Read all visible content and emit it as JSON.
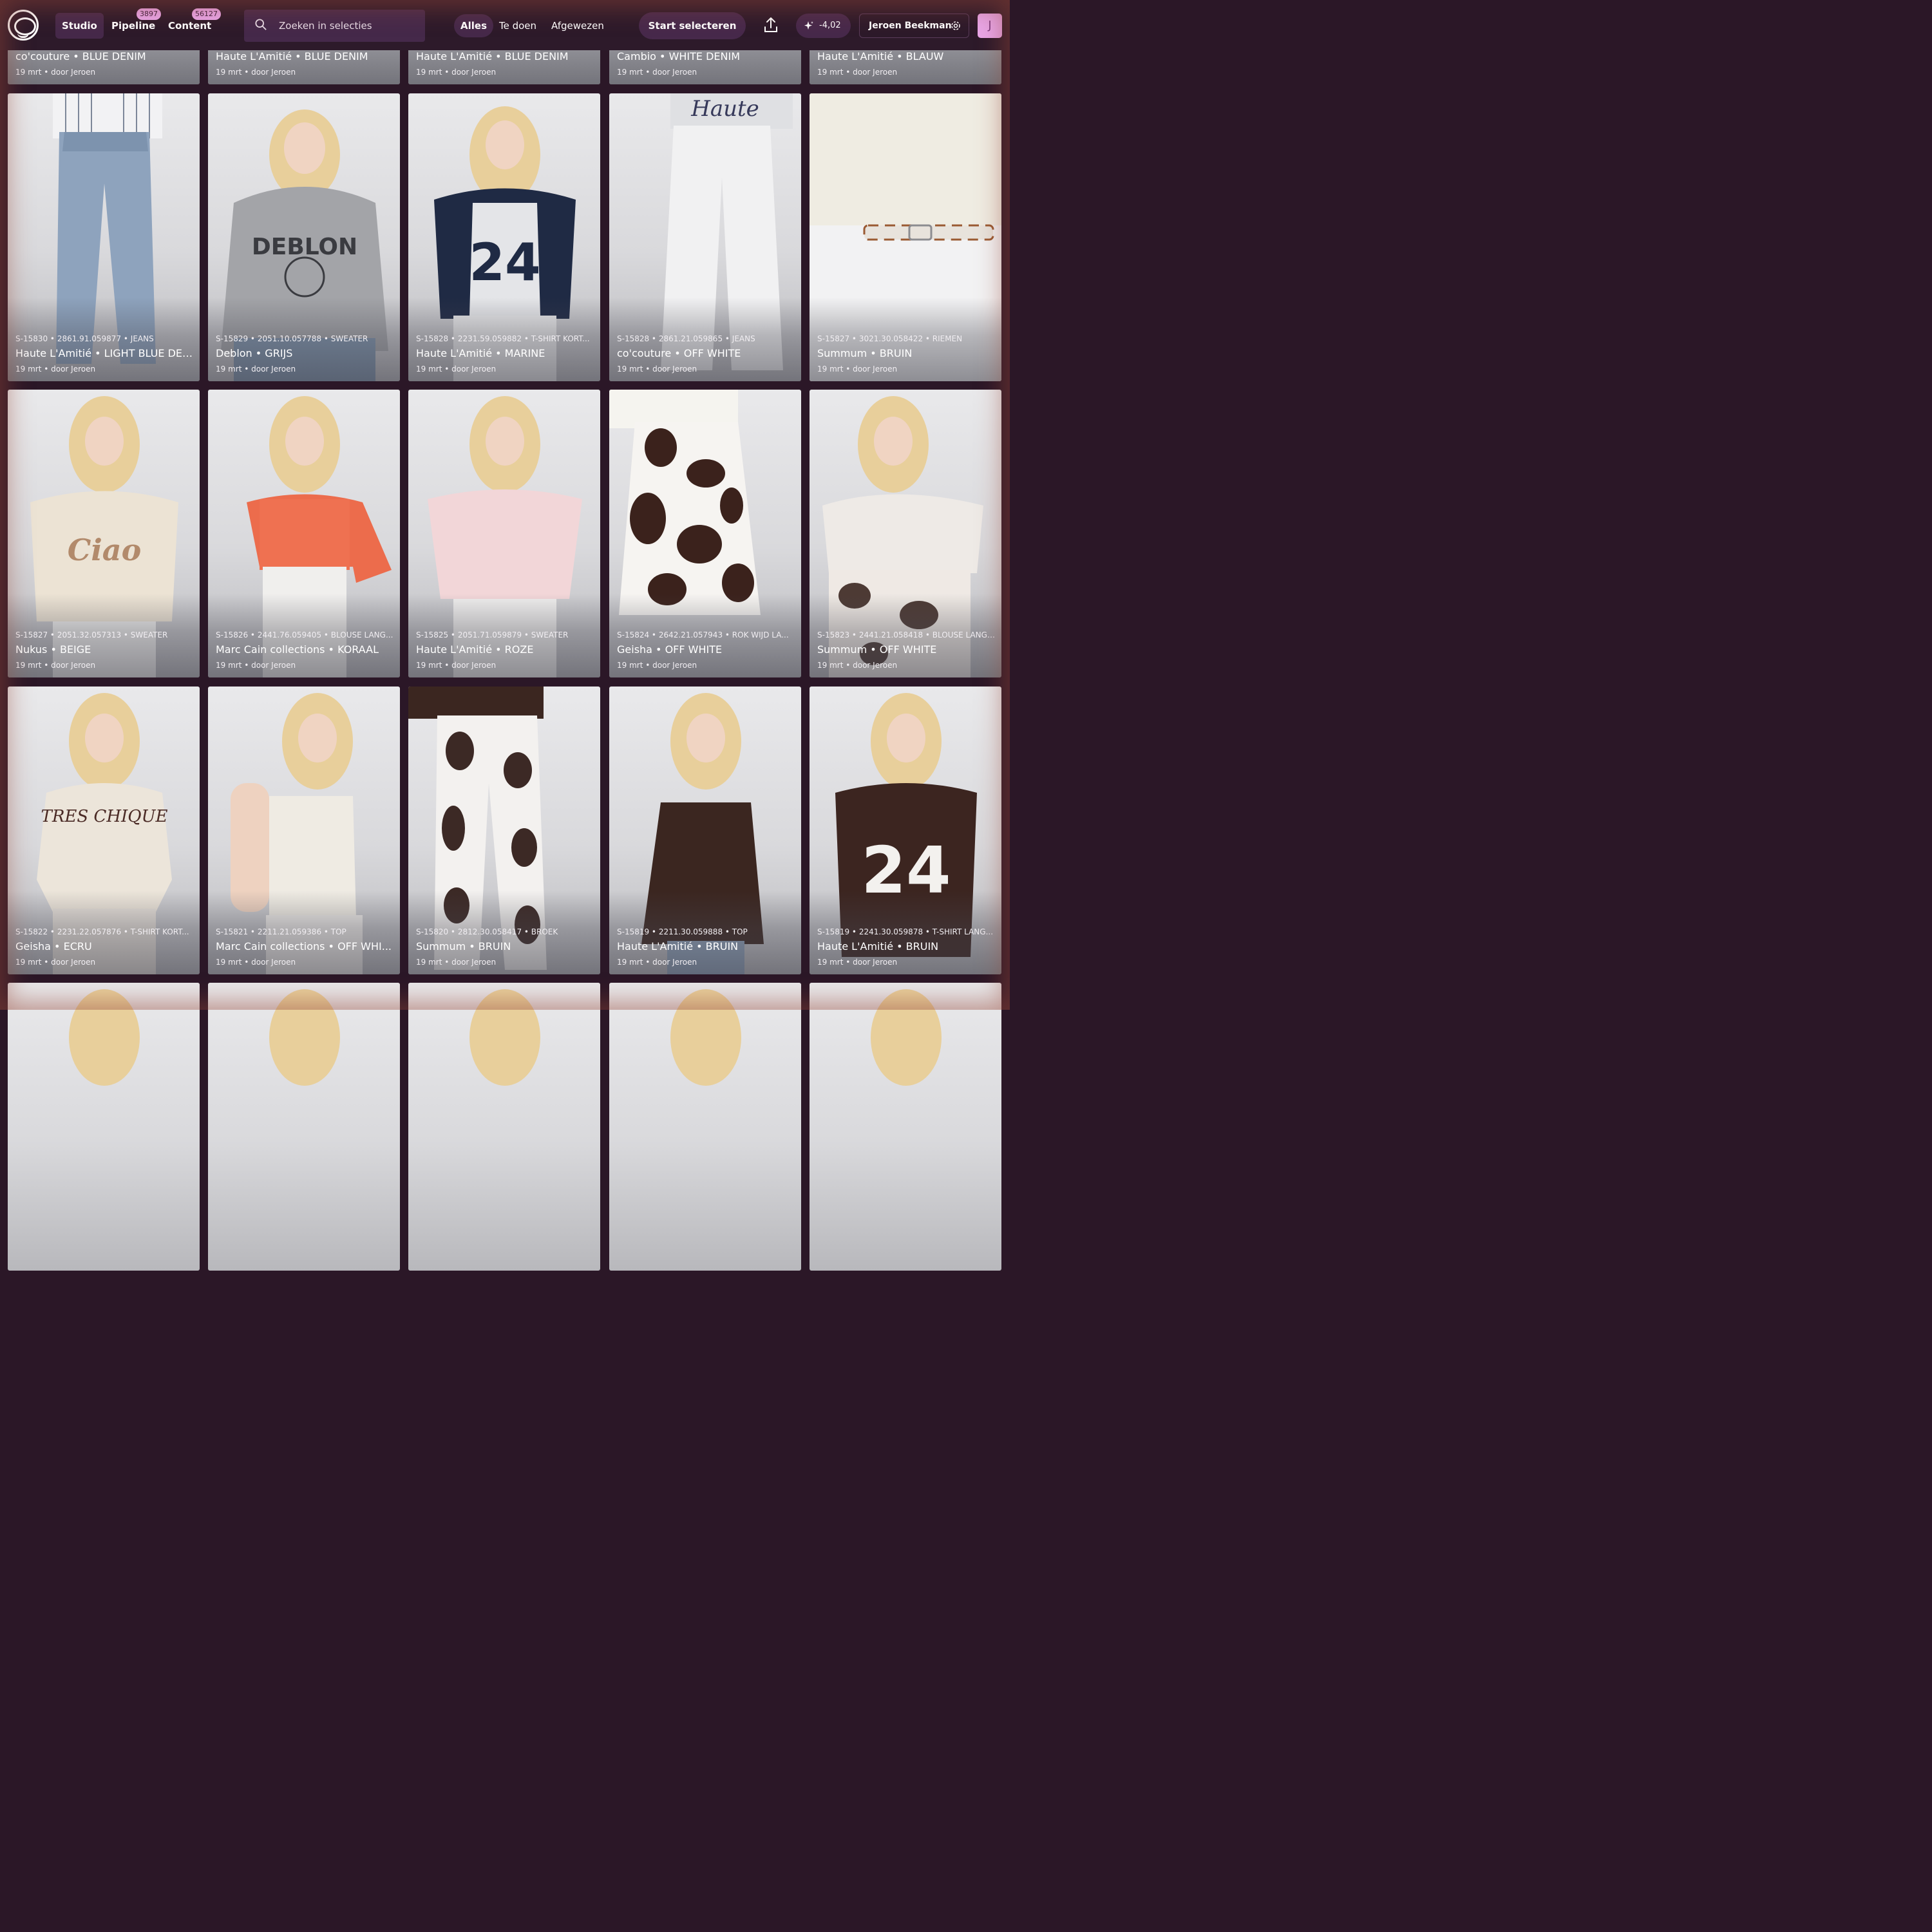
{
  "nav": {
    "tabs": [
      {
        "label": "Studio",
        "badge": ""
      },
      {
        "label": "Pipeline",
        "badge": "3897"
      },
      {
        "label": "Content",
        "badge": "56127"
      }
    ]
  },
  "search": {
    "placeholder": "Zoeken in selecties",
    "icon": "search-icon"
  },
  "filters": [
    "Alles",
    "Te doen",
    "Afgewezen"
  ],
  "actions": {
    "start_label": "Start selecteren",
    "upload_icon": "upload-icon",
    "credits": "-4,02",
    "user_name": "Jeroen Beekman",
    "avatar_initial": "J"
  },
  "colors": {
    "background": "#2b1727",
    "accent": "#e9a6e8",
    "pill": "#47294b"
  },
  "grid": {
    "row_top": [
      {
        "meta": "",
        "title": "co'couture • BLUE DENIM",
        "sub": "19 mrt • door Jeroen"
      },
      {
        "meta": "",
        "title": "Haute L'Amitié • BLUE DENIM",
        "sub": "19 mrt • door Jeroen"
      },
      {
        "meta": "",
        "title": "Haute L'Amitié • BLUE DENIM",
        "sub": "19 mrt • door Jeroen"
      },
      {
        "meta": "",
        "title": "Cambio • WHITE DENIM",
        "sub": "19 mrt • door Jeroen"
      },
      {
        "meta": "",
        "title": "Haute L'Amitié • BLAUW",
        "sub": "19 mrt • door Jeroen"
      }
    ],
    "row1": [
      {
        "meta": "S-15830 • 2861.91.059877 • JEANS",
        "title": "Haute L'Amitié • LIGHT BLUE DEN...",
        "sub": "19 mrt • door Jeroen"
      },
      {
        "meta": "S-15829 • 2051.10.057788 • SWEATER",
        "title": "Deblon • GRIJS",
        "sub": "19 mrt • door Jeroen"
      },
      {
        "meta": "S-15828 • 2231.59.059882 • T-SHIRT KORT...",
        "title": "Haute L'Amitié • MARINE",
        "sub": "19 mrt • door Jeroen"
      },
      {
        "meta": "S-15828 • 2861.21.059865 • JEANS",
        "title": "co'couture • OFF WHITE",
        "sub": "19 mrt • door Jeroen"
      },
      {
        "meta": "S-15827 • 3021.30.058422 • RIEMEN",
        "title": "Summum • BRUIN",
        "sub": "19 mrt • door Jeroen"
      }
    ],
    "row2": [
      {
        "meta": "S-15827 • 2051.32.057313 • SWEATER",
        "title": "Nukus • BEIGE",
        "sub": "19 mrt • door Jeroen"
      },
      {
        "meta": "S-15826 • 2441.76.059405 • BLOUSE LANG...",
        "title": "Marc Cain collections • KORAAL",
        "sub": "19 mrt • door Jeroen"
      },
      {
        "meta": "S-15825 • 2051.71.059879 • SWEATER",
        "title": "Haute L'Amitié • ROZE",
        "sub": "19 mrt • door Jeroen"
      },
      {
        "meta": "S-15824 • 2642.21.057943 • ROK WIJD LA...",
        "title": "Geisha • OFF WHITE",
        "sub": "19 mrt • door Jeroen"
      },
      {
        "meta": "S-15823 • 2441.21.058418 • BLOUSE LANGE...",
        "title": "Summum • OFF WHITE",
        "sub": "19 mrt • door Jeroen"
      }
    ],
    "row3": [
      {
        "meta": "S-15822 • 2231.22.057876 • T-SHIRT KORT...",
        "title": "Geisha • ECRU",
        "sub": "19 mrt • door Jeroen"
      },
      {
        "meta": "S-15821 • 2211.21.059386 • TOP",
        "title": "Marc Cain collections • OFF WHI...",
        "sub": "19 mrt • door Jeroen"
      },
      {
        "meta": "S-15820 • 2812.30.058417 • BROEK",
        "title": "Summum • BRUIN",
        "sub": "19 mrt • door Jeroen"
      },
      {
        "meta": "S-15819 • 2211.30.059888 • TOP",
        "title": "Haute L'Amitié • BRUIN",
        "sub": "19 mrt • door Jeroen"
      },
      {
        "meta": "S-15819 • 2241.30.059878 • T-SHIRT LANG...",
        "title": "Haute L'Amitié • BRUIN",
        "sub": "19 mrt • door Jeroen"
      }
    ]
  }
}
